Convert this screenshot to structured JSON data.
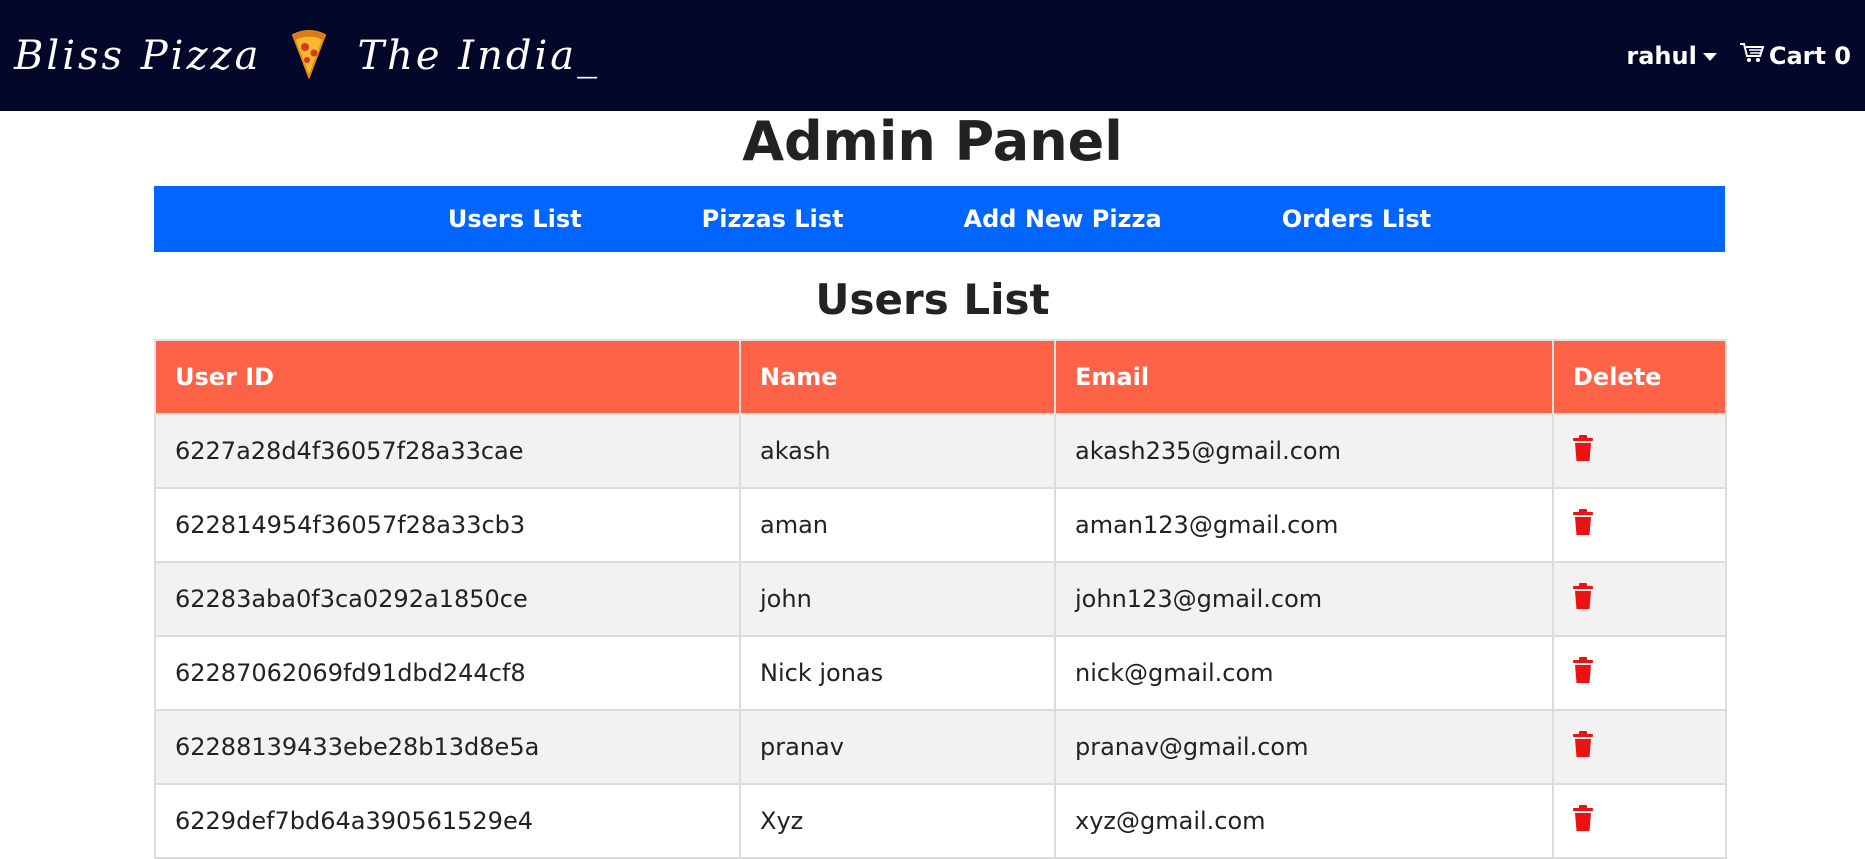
{
  "navbar": {
    "brand": "Bliss Pizza",
    "brand_icon": "pizza-slice-icon",
    "tagline": "The India_",
    "user": "rahul",
    "cart_label": "Cart 0",
    "background": "#03072a"
  },
  "page": {
    "title": "Admin Panel"
  },
  "admin_nav": {
    "background": "#0066ff",
    "items": [
      {
        "label": "Users List"
      },
      {
        "label": "Pizzas List"
      },
      {
        "label": "Add New Pizza"
      },
      {
        "label": "Orders List"
      }
    ]
  },
  "users_section": {
    "title": "Users List",
    "header_color": "#ff6347",
    "delete_icon_color": "#ee1111",
    "columns": [
      "User ID",
      "Name",
      "Email",
      "Delete"
    ],
    "rows": [
      {
        "id": "6227a28d4f36057f28a33cae",
        "name": "akash",
        "email": "akash235@gmail.com"
      },
      {
        "id": "622814954f36057f28a33cb3",
        "name": "aman",
        "email": "aman123@gmail.com"
      },
      {
        "id": "62283aba0f3ca0292a1850ce",
        "name": "john",
        "email": "john123@gmail.com"
      },
      {
        "id": "62287062069fd91dbd244cf8",
        "name": "Nick jonas",
        "email": "nick@gmail.com"
      },
      {
        "id": "62288139433ebe28b13d8e5a",
        "name": "pranav",
        "email": "pranav@gmail.com"
      },
      {
        "id": "6229def7bd64a390561529e4",
        "name": "Xyz",
        "email": "xyz@gmail.com"
      }
    ]
  }
}
